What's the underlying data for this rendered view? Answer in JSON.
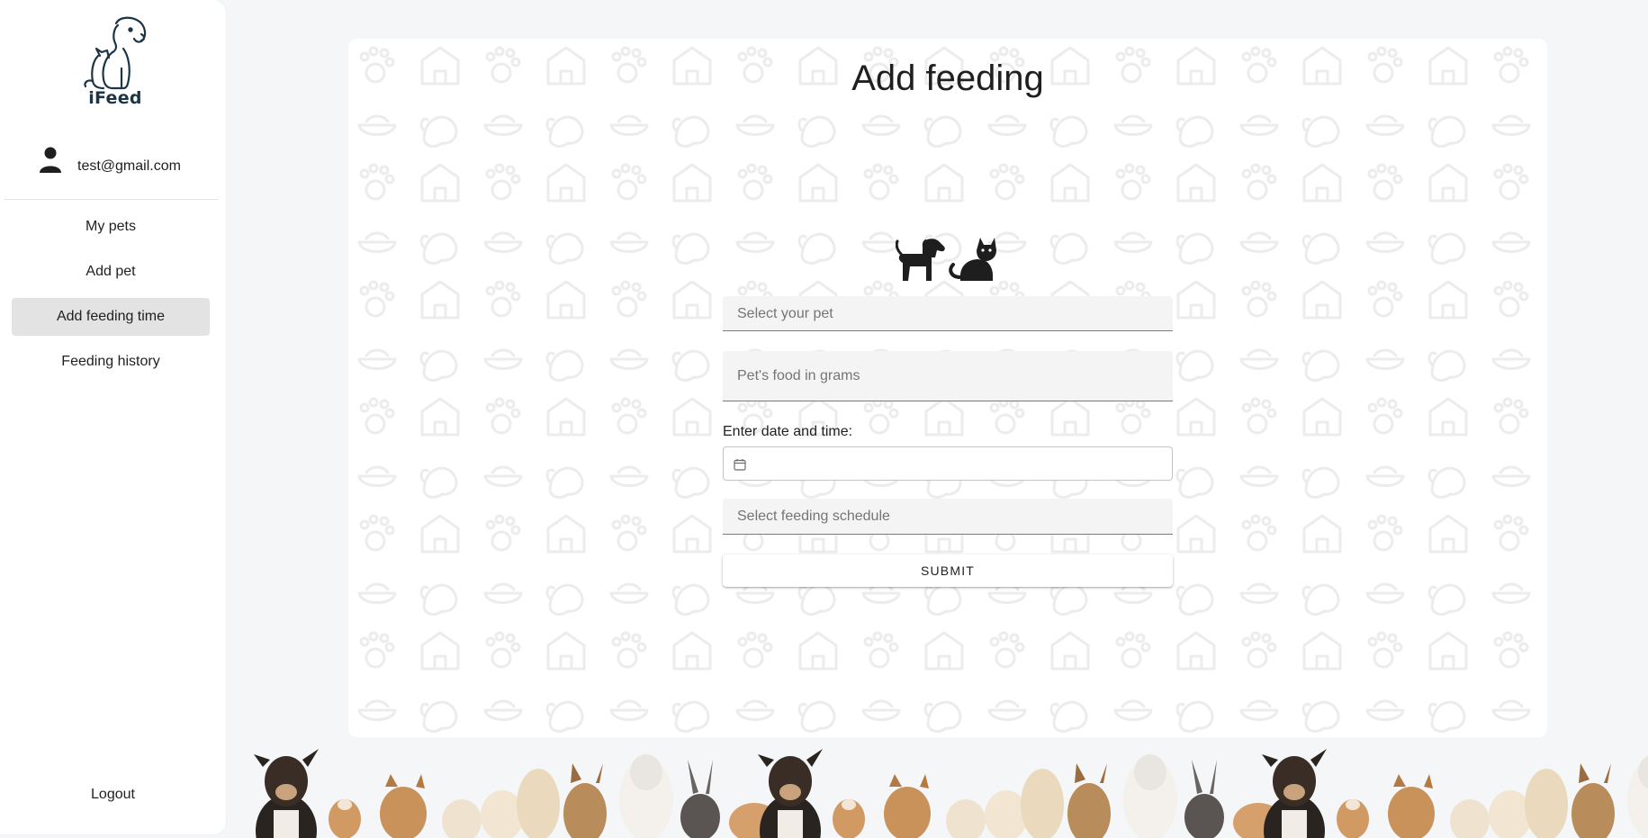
{
  "app": {
    "name": "iFeed"
  },
  "sidebar": {
    "user_email": "test@gmail.com",
    "items": [
      {
        "label": "My pets",
        "active": false
      },
      {
        "label": "Add pet",
        "active": false
      },
      {
        "label": "Add feeding time",
        "active": true
      },
      {
        "label": "Feeding history",
        "active": false
      }
    ],
    "logout_label": "Logout"
  },
  "main": {
    "title": "Add feeding",
    "form": {
      "pet_select": {
        "placeholder": "Select your pet",
        "value": ""
      },
      "food_grams": {
        "placeholder": "Pet's food in grams",
        "value": ""
      },
      "datetime": {
        "label": "Enter date and time:",
        "value": ""
      },
      "schedule_select": {
        "placeholder": "Select feeding schedule",
        "value": ""
      },
      "submit_label": "SUBMIT"
    }
  },
  "colors": {
    "page_bg": "#f5f6f8",
    "sidebar_bg": "#ffffff",
    "active_item_bg": "#e3e3e3",
    "field_bg": "#f4f4f4",
    "logo_text": "#1c3545"
  }
}
